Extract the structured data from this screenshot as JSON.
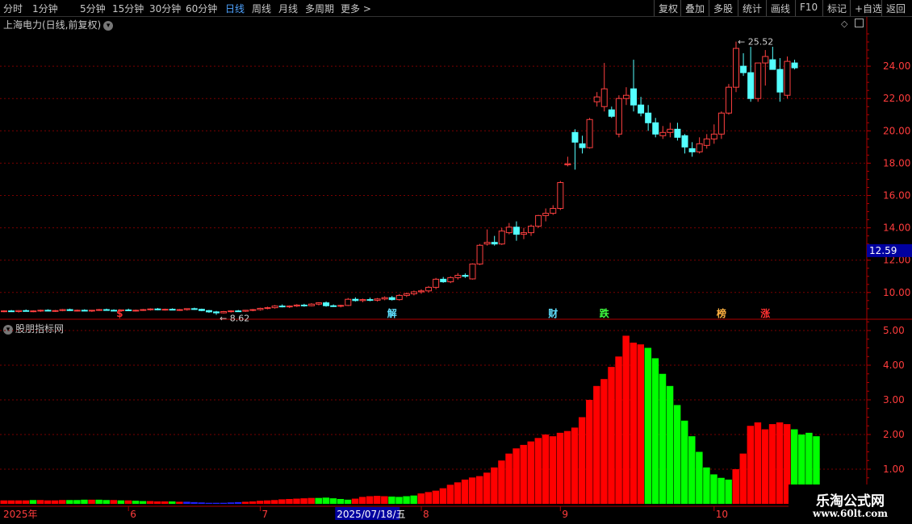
{
  "toolbar": {
    "periods": [
      "分时",
      "1分钟",
      "5分钟",
      "15分钟",
      "30分钟",
      "60分钟",
      "日线",
      "周线",
      "月线",
      "多周期",
      "更多"
    ],
    "active_period": "日线",
    "right_buttons": [
      "复权",
      "叠加",
      "多股",
      "统计",
      "画线",
      "F10",
      "标记",
      "+自选",
      "返回"
    ]
  },
  "main_chart": {
    "title": "上海电力(日线,前复权)",
    "current_price_label": "12.59",
    "high_annotation": "25.52",
    "low_annotation": "8.62",
    "event_markers": [
      {
        "label": "$",
        "color": "#ff3030",
        "index": 16
      },
      {
        "label": "解",
        "color": "#5fe0ff",
        "index": 53
      },
      {
        "label": "财",
        "color": "#5fe0ff",
        "index": 75
      },
      {
        "label": "跌",
        "color": "#40ff40",
        "index": 82
      },
      {
        "label": "榜",
        "color": "#ffb040",
        "index": 98
      },
      {
        "label": "涨",
        "color": "#ff3030",
        "index": 104
      }
    ]
  },
  "sub_chart": {
    "title": "股朋指标网"
  },
  "time_axis": {
    "labels": [
      {
        "text": "2025年",
        "index": 0
      },
      {
        "text": "6",
        "index": 17
      },
      {
        "text": "7",
        "index": 35
      },
      {
        "text": "8",
        "index": 57
      },
      {
        "text": "9",
        "index": 76
      },
      {
        "text": "10",
        "index": 97
      }
    ],
    "cursor_label": "2025/07/18/五",
    "cursor_index": 47
  },
  "watermark": {
    "title": "乐淘公式网",
    "url": "www.60lt.com"
  },
  "colors": {
    "up": "#ff4040",
    "down": "#54ffff",
    "grid": "#7a0000",
    "axis": "#b00000",
    "bar_red": "#ff0000",
    "bar_green": "#00ff00",
    "bar_blue": "#2020ff",
    "price_tag_bg": "#0000a0"
  },
  "chart_data": [
    {
      "type": "candlestick",
      "title": "上海电力(日线,前复权)",
      "ylim": [
        8.5,
        26.2
      ],
      "yticks": [
        10,
        12,
        14,
        16,
        18,
        20,
        22,
        24
      ],
      "grid": true,
      "candles": [
        [
          8.82,
          8.9,
          8.78,
          8.86
        ],
        [
          8.86,
          8.92,
          8.8,
          8.82
        ],
        [
          8.82,
          8.9,
          8.76,
          8.88
        ],
        [
          8.88,
          8.95,
          8.82,
          8.84
        ],
        [
          8.84,
          8.9,
          8.78,
          8.86
        ],
        [
          8.86,
          8.94,
          8.8,
          8.9
        ],
        [
          8.9,
          8.96,
          8.84,
          8.86
        ],
        [
          8.86,
          8.92,
          8.8,
          8.88
        ],
        [
          8.88,
          8.98,
          8.84,
          8.94
        ],
        [
          8.94,
          9.0,
          8.86,
          8.88
        ],
        [
          8.88,
          8.94,
          8.82,
          8.9
        ],
        [
          8.9,
          8.96,
          8.84,
          8.86
        ],
        [
          8.86,
          8.92,
          8.8,
          8.9
        ],
        [
          8.9,
          8.98,
          8.86,
          8.94
        ],
        [
          8.94,
          9.0,
          8.88,
          8.9
        ],
        [
          8.9,
          8.96,
          8.84,
          8.88
        ],
        [
          8.88,
          8.94,
          8.82,
          8.92
        ],
        [
          8.92,
          9.0,
          8.86,
          8.88
        ],
        [
          8.88,
          8.94,
          8.82,
          8.9
        ],
        [
          8.9,
          8.98,
          8.86,
          8.94
        ],
        [
          8.94,
          9.02,
          8.88,
          8.98
        ],
        [
          8.98,
          9.04,
          8.9,
          8.94
        ],
        [
          8.94,
          9.0,
          8.88,
          8.96
        ],
        [
          8.96,
          9.02,
          8.9,
          8.92
        ],
        [
          8.92,
          8.98,
          8.86,
          8.94
        ],
        [
          8.94,
          9.0,
          8.88,
          9.0
        ],
        [
          9.0,
          9.06,
          8.92,
          8.96
        ],
        [
          8.96,
          9.0,
          8.84,
          8.88
        ],
        [
          8.88,
          8.92,
          8.74,
          8.8
        ],
        [
          8.8,
          8.86,
          8.62,
          8.74
        ],
        [
          8.74,
          8.86,
          8.7,
          8.82
        ],
        [
          8.82,
          8.9,
          8.76,
          8.86
        ],
        [
          8.86,
          8.92,
          8.8,
          8.84
        ],
        [
          8.84,
          8.92,
          8.8,
          8.9
        ],
        [
          8.9,
          8.98,
          8.84,
          8.94
        ],
        [
          8.94,
          9.06,
          8.88,
          9.02
        ],
        [
          9.02,
          9.12,
          8.96,
          9.06
        ],
        [
          9.06,
          9.22,
          9.0,
          9.16
        ],
        [
          9.16,
          9.26,
          9.08,
          9.12
        ],
        [
          9.12,
          9.2,
          9.04,
          9.16
        ],
        [
          9.16,
          9.28,
          9.1,
          9.22
        ],
        [
          9.22,
          9.3,
          9.12,
          9.18
        ],
        [
          9.18,
          9.34,
          9.14,
          9.28
        ],
        [
          9.28,
          9.4,
          9.2,
          9.36
        ],
        [
          9.36,
          9.44,
          9.12,
          9.18
        ],
        [
          9.18,
          9.26,
          9.1,
          9.16
        ],
        [
          9.16,
          9.24,
          9.08,
          9.2
        ],
        [
          9.2,
          9.66,
          9.16,
          9.58
        ],
        [
          9.58,
          9.7,
          9.44,
          9.5
        ],
        [
          9.5,
          9.62,
          9.4,
          9.56
        ],
        [
          9.56,
          9.68,
          9.46,
          9.52
        ],
        [
          9.52,
          9.66,
          9.44,
          9.6
        ],
        [
          9.6,
          9.76,
          9.52,
          9.68
        ],
        [
          9.68,
          9.78,
          9.5,
          9.56
        ],
        [
          9.56,
          9.9,
          9.5,
          9.82
        ],
        [
          9.82,
          10.0,
          9.72,
          9.92
        ],
        [
          9.92,
          10.12,
          9.82,
          10.04
        ],
        [
          10.04,
          10.2,
          9.92,
          10.1
        ],
        [
          10.1,
          10.4,
          10.0,
          10.32
        ],
        [
          10.32,
          10.9,
          10.2,
          10.82
        ],
        [
          10.82,
          10.96,
          10.6,
          10.66
        ],
        [
          10.66,
          11.0,
          10.58,
          10.92
        ],
        [
          10.92,
          11.2,
          10.8,
          11.06
        ],
        [
          11.06,
          11.18,
          10.9,
          11.0
        ],
        [
          10.84,
          11.8,
          10.8,
          11.76
        ],
        [
          11.76,
          13.0,
          11.7,
          12.92
        ],
        [
          13.0,
          13.9,
          12.9,
          13.1
        ],
        [
          13.1,
          13.5,
          12.9,
          13.0
        ],
        [
          13.0,
          14.0,
          12.94,
          13.8
        ],
        [
          13.7,
          14.3,
          13.6,
          14.04
        ],
        [
          14.04,
          14.4,
          13.2,
          13.6
        ],
        [
          13.6,
          14.0,
          13.3,
          13.7
        ],
        [
          13.7,
          14.2,
          13.5,
          14.1
        ],
        [
          14.1,
          14.8,
          14.0,
          14.76
        ],
        [
          14.76,
          15.2,
          14.4,
          14.9
        ],
        [
          14.9,
          15.4,
          14.8,
          15.2
        ],
        [
          15.2,
          16.9,
          15.1,
          16.8
        ],
        [
          17.9,
          18.4,
          17.8,
          17.96
        ],
        [
          19.9,
          20.1,
          17.6,
          19.3
        ],
        [
          19.2,
          19.7,
          18.6,
          18.96
        ],
        [
          18.96,
          20.8,
          18.9,
          20.7
        ],
        [
          21.8,
          22.4,
          21.5,
          22.1
        ],
        [
          21.5,
          24.2,
          21.2,
          22.6
        ],
        [
          21.3,
          21.5,
          20.8,
          20.9
        ],
        [
          19.8,
          22.2,
          19.6,
          22.0
        ],
        [
          22.0,
          22.7,
          21.6,
          22.2
        ],
        [
          22.6,
          24.4,
          21.2,
          21.6
        ],
        [
          21.6,
          22.1,
          20.9,
          21.1
        ],
        [
          21.1,
          21.6,
          20.0,
          20.5
        ],
        [
          20.5,
          20.8,
          19.6,
          19.8
        ],
        [
          19.7,
          20.3,
          19.5,
          19.9
        ],
        [
          19.9,
          20.5,
          19.6,
          20.1
        ],
        [
          20.1,
          20.5,
          19.4,
          19.6
        ],
        [
          19.7,
          19.8,
          18.6,
          19.0
        ],
        [
          18.9,
          19.3,
          18.4,
          18.7
        ],
        [
          18.7,
          19.6,
          18.6,
          19.2
        ],
        [
          19.1,
          19.8,
          18.9,
          19.5
        ],
        [
          19.5,
          20.4,
          19.2,
          19.8
        ],
        [
          19.8,
          21.2,
          19.5,
          21.1
        ],
        [
          21.1,
          22.9,
          21.0,
          22.7
        ],
        [
          22.7,
          25.52,
          22.4,
          25.1
        ],
        [
          24.0,
          24.8,
          23.4,
          23.6
        ],
        [
          23.6,
          25.2,
          21.8,
          22.0
        ],
        [
          22.0,
          24.2,
          21.8,
          24.2
        ],
        [
          24.2,
          25.0,
          22.8,
          24.6
        ],
        [
          24.4,
          25.2,
          23.8,
          23.8
        ],
        [
          23.8,
          24.5,
          21.8,
          22.4
        ],
        [
          22.2,
          24.6,
          22.0,
          24.3
        ],
        [
          24.2,
          24.4,
          23.8,
          23.9
        ]
      ]
    },
    {
      "type": "bar",
      "title": "股朋指标网",
      "ylim": [
        0,
        5.3
      ],
      "yticks": [
        1,
        2,
        3,
        4,
        5
      ],
      "grid": true,
      "values": [
        0.1,
        0.1,
        0.1,
        0.1,
        0.11,
        0.11,
        0.1,
        0.1,
        0.11,
        0.11,
        0.11,
        0.12,
        0.12,
        0.12,
        0.11,
        0.11,
        0.1,
        0.1,
        0.09,
        0.08,
        0.08,
        0.07,
        0.07,
        0.07,
        0.06,
        0.06,
        0.05,
        0.04,
        0.03,
        0.03,
        0.03,
        0.04,
        0.05,
        0.06,
        0.07,
        0.09,
        0.1,
        0.11,
        0.13,
        0.14,
        0.15,
        0.16,
        0.17,
        0.17,
        0.18,
        0.16,
        0.14,
        0.12,
        0.15,
        0.2,
        0.22,
        0.23,
        0.22,
        0.21,
        0.2,
        0.22,
        0.24,
        0.3,
        0.34,
        0.38,
        0.45,
        0.55,
        0.62,
        0.7,
        0.76,
        0.8,
        0.9,
        1.05,
        1.25,
        1.45,
        1.6,
        1.7,
        1.8,
        1.9,
        2.0,
        1.95,
        2.05,
        2.1,
        2.2,
        2.5,
        3.0,
        3.4,
        3.6,
        3.95,
        4.25,
        4.85,
        4.65,
        4.6,
        4.5,
        4.2,
        3.75,
        3.4,
        2.85,
        2.4,
        1.95,
        1.5,
        1.05,
        0.85,
        0.75,
        0.7,
        1.0,
        1.45,
        2.25,
        2.35,
        2.15,
        2.3,
        2.35,
        2.3,
        2.15,
        2.0,
        2.05,
        1.95
      ],
      "colors": [
        "r",
        "r",
        "r",
        "r",
        "g",
        "r",
        "r",
        "r",
        "r",
        "g",
        "g",
        "g",
        "r",
        "g",
        "g",
        "r",
        "g",
        "r",
        "g",
        "g",
        "r",
        "r",
        "r",
        "g",
        "r",
        "b",
        "b",
        "b",
        "b",
        "b",
        "b",
        "b",
        "b",
        "r",
        "r",
        "r",
        "r",
        "r",
        "r",
        "r",
        "r",
        "r",
        "r",
        "g",
        "g",
        "g",
        "g",
        "g",
        "r",
        "r",
        "r",
        "r",
        "r",
        "g",
        "g",
        "g",
        "g",
        "r",
        "r",
        "r",
        "r",
        "r",
        "r",
        "r",
        "r",
        "r",
        "r",
        "r",
        "r",
        "r",
        "r",
        "r",
        "r",
        "r",
        "r",
        "r",
        "r",
        "r",
        "r",
        "r",
        "r",
        "r",
        "r",
        "r",
        "r",
        "r",
        "r",
        "r",
        "g",
        "g",
        "g",
        "g",
        "g",
        "g",
        "g",
        "g",
        "g",
        "g",
        "g",
        "g",
        "r",
        "r",
        "r",
        "r",
        "r",
        "r",
        "r",
        "r",
        "g",
        "g",
        "g",
        "g"
      ]
    }
  ]
}
